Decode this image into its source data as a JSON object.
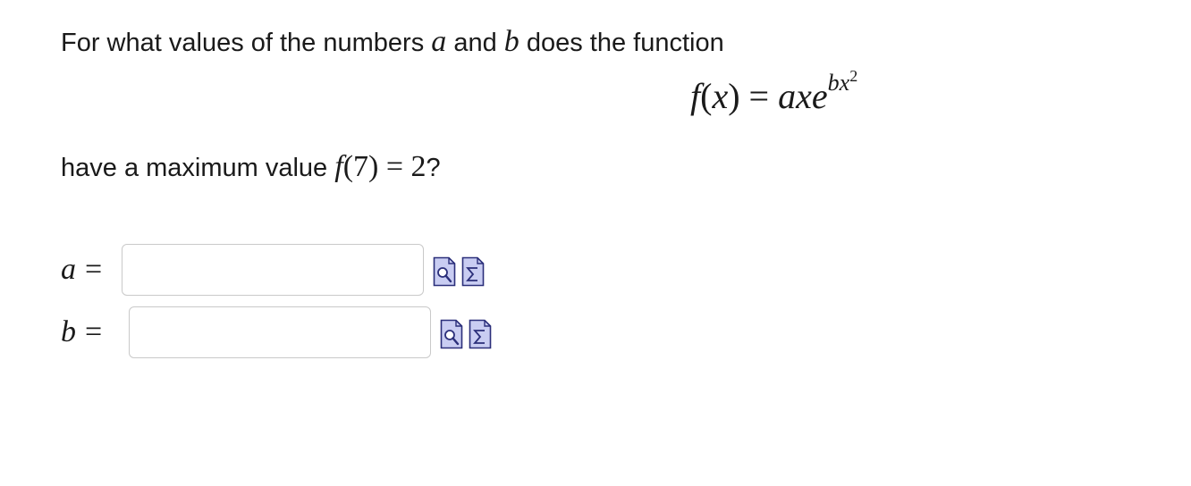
{
  "question": {
    "line1_prefix": "For what values of the numbers ",
    "var_a": "a",
    "line1_and": " and ",
    "var_b": "b",
    "line1_suffix": " does the function",
    "line2_prefix": "have a maximum value ",
    "condition_f": "f",
    "condition_arg": "(7)",
    "condition_eq": " = 2",
    "line2_suffix": "?"
  },
  "equation": {
    "lhs_f": "f",
    "lhs_open": "(",
    "lhs_x": "x",
    "lhs_close": ")",
    "equals": " = ",
    "rhs_a": "a",
    "rhs_x": "x",
    "rhs_e": "e",
    "exp_b": "b",
    "exp_x": "x",
    "exp_pow": "2"
  },
  "answers": [
    {
      "variable": "a",
      "equals": "=",
      "value": "",
      "placeholder": ""
    },
    {
      "variable": "b",
      "equals": "=",
      "value": "",
      "placeholder": ""
    }
  ],
  "tools": {
    "preview_icon": "preview-magnifier-icon",
    "math_palette_icon": "sigma-palette-icon",
    "accent_fill": "#c9cdf2",
    "accent_stroke": "#2b2f7a"
  }
}
